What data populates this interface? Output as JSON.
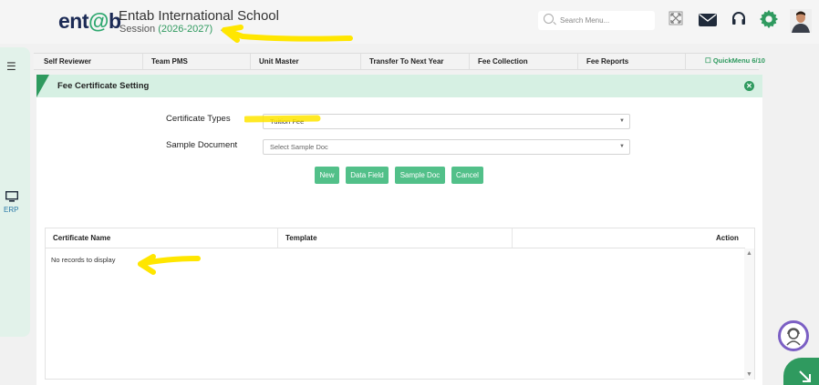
{
  "header": {
    "logo_text_a": "ent",
    "logo_text_b": "@",
    "logo_text_c": "b",
    "school_name": "Entab International School",
    "session_label": "Session",
    "session_year": "(2026-2027)",
    "search_placeholder": "Search Menu..."
  },
  "rail": {
    "erp_label": "ERP"
  },
  "nav": {
    "tabs": [
      "Self Reviewer",
      "Team PMS",
      "Unit Master",
      "Transfer To Next Year",
      "Fee Collection",
      "Fee Reports"
    ],
    "quickmenu": "QuickMenu 6/10"
  },
  "panel": {
    "title": "Fee Certificate Setting",
    "certificate_types_label": "Certificate Types",
    "certificate_types_value": "Tuition Fee",
    "sample_document_label": "Sample Document",
    "sample_document_placeholder": "Select Sample Doc",
    "buttons": {
      "new": "New",
      "data_field": "Data Field",
      "sample_doc": "Sample Doc",
      "cancel": "Cancel"
    }
  },
  "grid": {
    "columns": [
      "Certificate Name",
      "Template",
      "Action"
    ],
    "empty_message": "No records to display"
  },
  "colors": {
    "brand_green": "#2f9a5f",
    "button_green": "#52c089",
    "header_tint": "#d6f0e3",
    "highlight_yellow": "#ffe600"
  }
}
